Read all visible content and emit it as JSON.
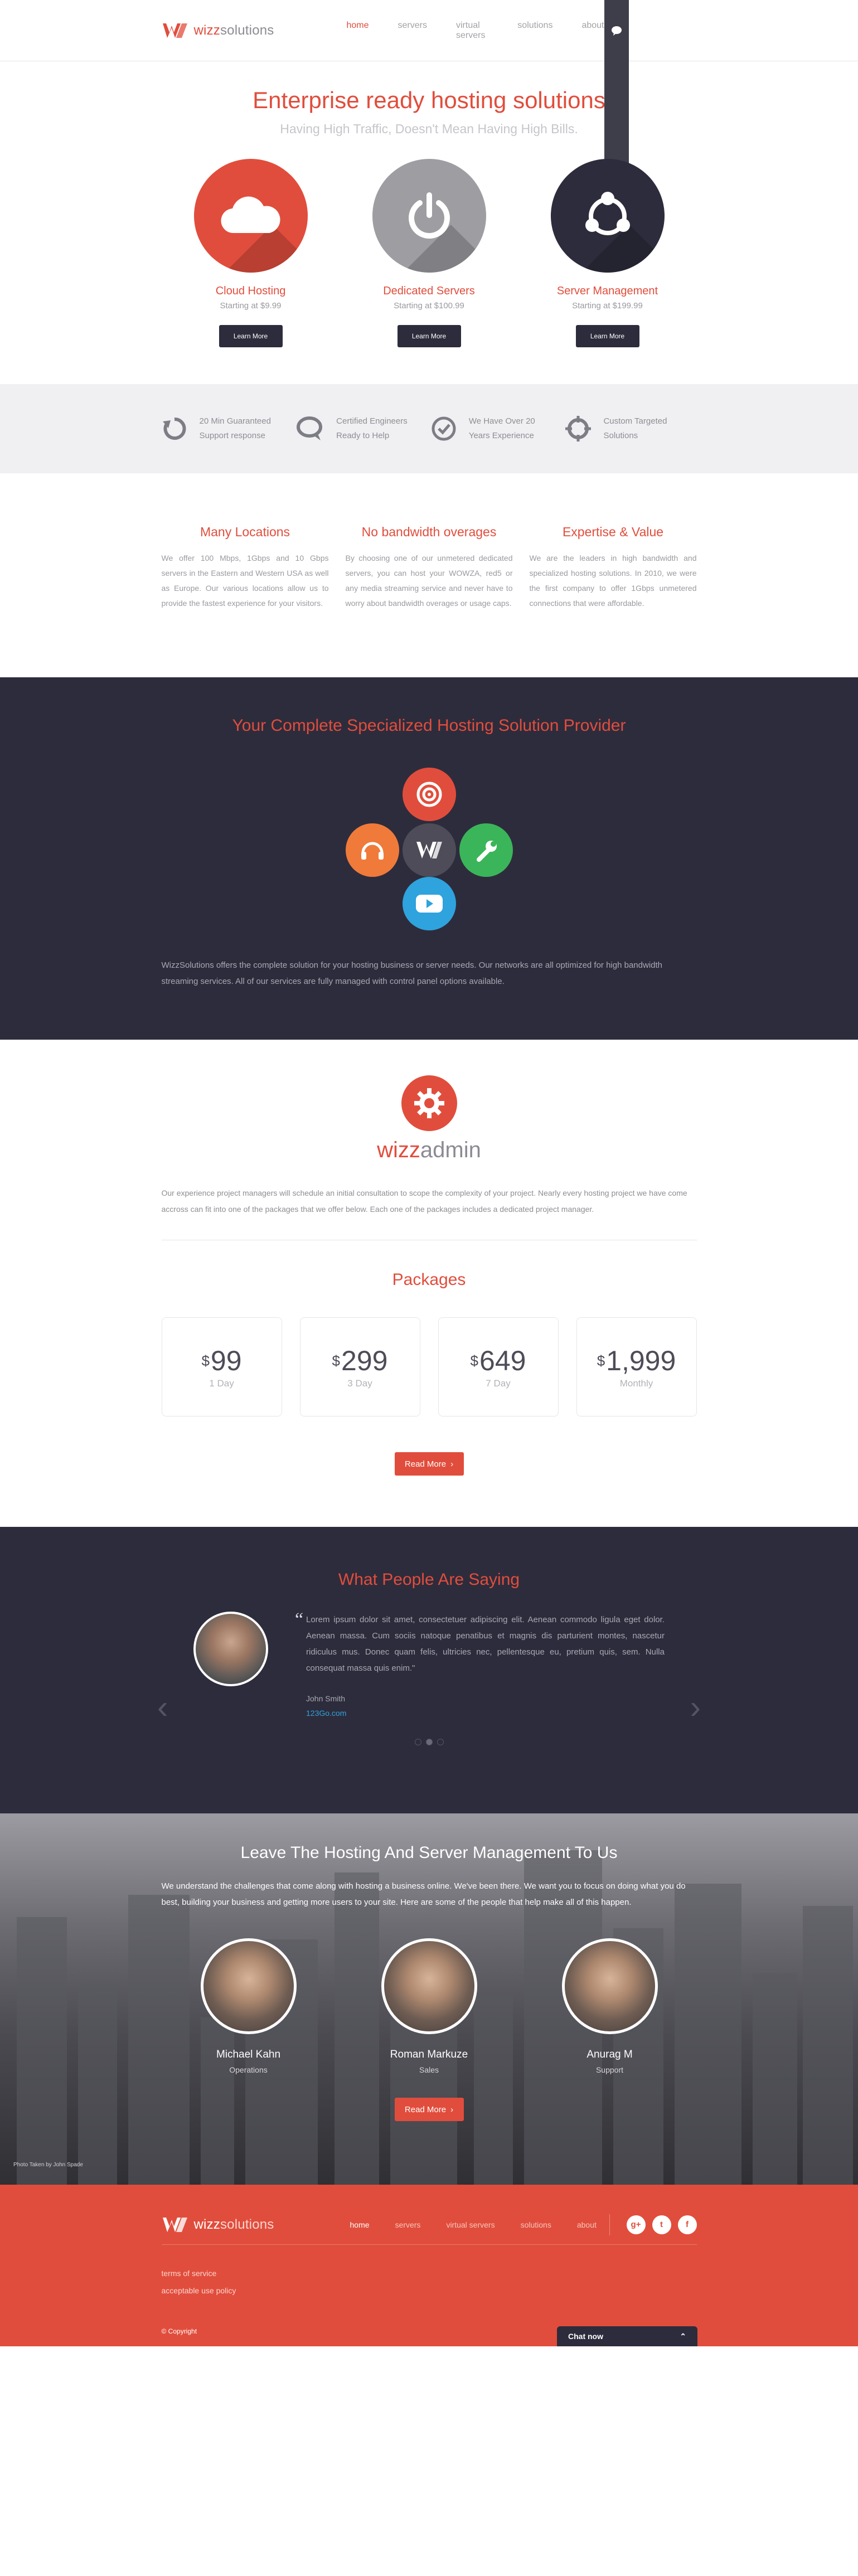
{
  "brand": {
    "name_strong": "wizz",
    "name_light": "solutions",
    "accent": "#e14d3c",
    "dark": "#2d2c3c",
    "blue": "#2ea3dd"
  },
  "header": {
    "nav": [
      "home",
      "servers",
      "virtual servers",
      "solutions",
      "about"
    ],
    "chat_icon": "chat-bubble-icon",
    "mail_icon": "mail-icon",
    "signin": "signin"
  },
  "hero": {
    "title": "Enterprise ready hosting solutions",
    "subtitle": "Having High Traffic, Doesn't Mean Having High Bills."
  },
  "services": [
    {
      "title": "Cloud Hosting",
      "price": "Starting at $9.99",
      "button": "Learn More",
      "icon": "cloud-icon",
      "color": "#e14d3c"
    },
    {
      "title": "Dedicated Servers",
      "price": "Starting at $100.99",
      "button": "Learn More",
      "icon": "power-icon",
      "color": "#9d9da2"
    },
    {
      "title": "Server Management",
      "price": "Starting at $199.99",
      "button": "Learn More",
      "icon": "network-icon",
      "color": "#2d2c3c"
    }
  ],
  "features": [
    {
      "line1": "20 Min Guaranteed",
      "line2": "Support response",
      "icon": "refresh-icon"
    },
    {
      "line1": "Certified Engineers",
      "line2": "Ready to Help",
      "icon": "speech-bubble-icon"
    },
    {
      "line1": "We Have Over 20",
      "line2": "Years Experience",
      "icon": "check-circle-icon"
    },
    {
      "line1": "Custom Targeted",
      "line2": "Solutions",
      "icon": "crosshair-icon"
    }
  ],
  "columns": [
    {
      "title": "Many Locations",
      "text": "We offer 100 Mbps, 1Gbps and 10 Gbps servers in the Eastern and Western USA as well as Europe. Our various locations allow us to provide the fastest experience for your visitors."
    },
    {
      "title": "No bandwidth overages",
      "text": "By choosing one of our unmetered dedicated servers, you can host your WOWZA, red5 or any media streaming service and never have to worry about bandwidth overages or usage caps."
    },
    {
      "title": "Expertise & Value",
      "text": "We are the leaders in high bandwidth and specialized hosting solutions. In 2010, we were the first company to offer 1Gbps unmetered connections that were affordable."
    }
  ],
  "solution": {
    "title": "Your Complete Specialized Hosting Solution Provider",
    "text": "WizzSolutions offers the complete solution for your hosting business or server needs. Our networks are all optimized for high bandwidth streaming services. All of our services are fully managed with control panel options available.",
    "nodes": [
      {
        "icon": "target-icon",
        "color": "#e14d3c"
      },
      {
        "icon": "headset-icon",
        "color": "#f07a3a"
      },
      {
        "icon": "wrench-icon",
        "color": "#3bb55a"
      },
      {
        "icon": "play-icon",
        "color": "#2ea3dd"
      },
      {
        "icon": "wizz-logo-icon",
        "color": "#4d4c58"
      }
    ]
  },
  "admin": {
    "logo_strong": "wizz",
    "logo_light": "admin",
    "text": "Our experience project managers will schedule an initial consultation to scope the complexity of your project. Nearly every hosting project we have come accross can fit into one of the packages that we offer below. Each one of the packages includes a dedicated project manager.",
    "packages_title": "Packages",
    "packages": [
      {
        "currency": "$",
        "amount": "99",
        "period": "1 Day"
      },
      {
        "currency": "$",
        "amount": "299",
        "period": "3 Day"
      },
      {
        "currency": "$",
        "amount": "649",
        "period": "7 Day"
      },
      {
        "currency": "$",
        "amount": "1,999",
        "period": "Monthly"
      }
    ],
    "read_more": "Read More"
  },
  "testimonials": {
    "title": "What People Are Saying",
    "quote": "Lorem ipsum dolor sit amet, consectetuer adipiscing elit. Aenean commodo ligula eget dolor. Aenean massa. Cum sociis natoque penatibus et magnis dis parturient montes, nascetur ridiculus mus. Donec quam felis, ultricies nec, pellentesque eu, pretium quis, sem. Nulla consequat massa quis enim.\"",
    "name": "John Smith",
    "site": "123Go.com",
    "active_dot": 2,
    "dot_count": 3
  },
  "team": {
    "title": "Leave The Hosting And Server Management To Us",
    "intro": "We understand the challenges that come along with hosting a business online. We've been there. We want you to focus on doing what you do best, building your business and getting more users to your site. Here are some of the people that help make all of this happen.",
    "members": [
      {
        "name": "Michael Kahn",
        "role": "Operations"
      },
      {
        "name": "Roman Markuze",
        "role": "Sales"
      },
      {
        "name": "Anurag M",
        "role": "Support"
      }
    ],
    "read_more": "Read More",
    "photo_credit": "Photo Taken by John Spade"
  },
  "footer": {
    "nav": [
      "home",
      "servers",
      "virtual servers",
      "solutions",
      "about"
    ],
    "social": [
      "google-plus-icon",
      "twitter-icon",
      "facebook-icon"
    ],
    "links": [
      "terms of service",
      "acceptable use policy"
    ],
    "copyright": "© Copyright",
    "chat": "Chat now"
  }
}
